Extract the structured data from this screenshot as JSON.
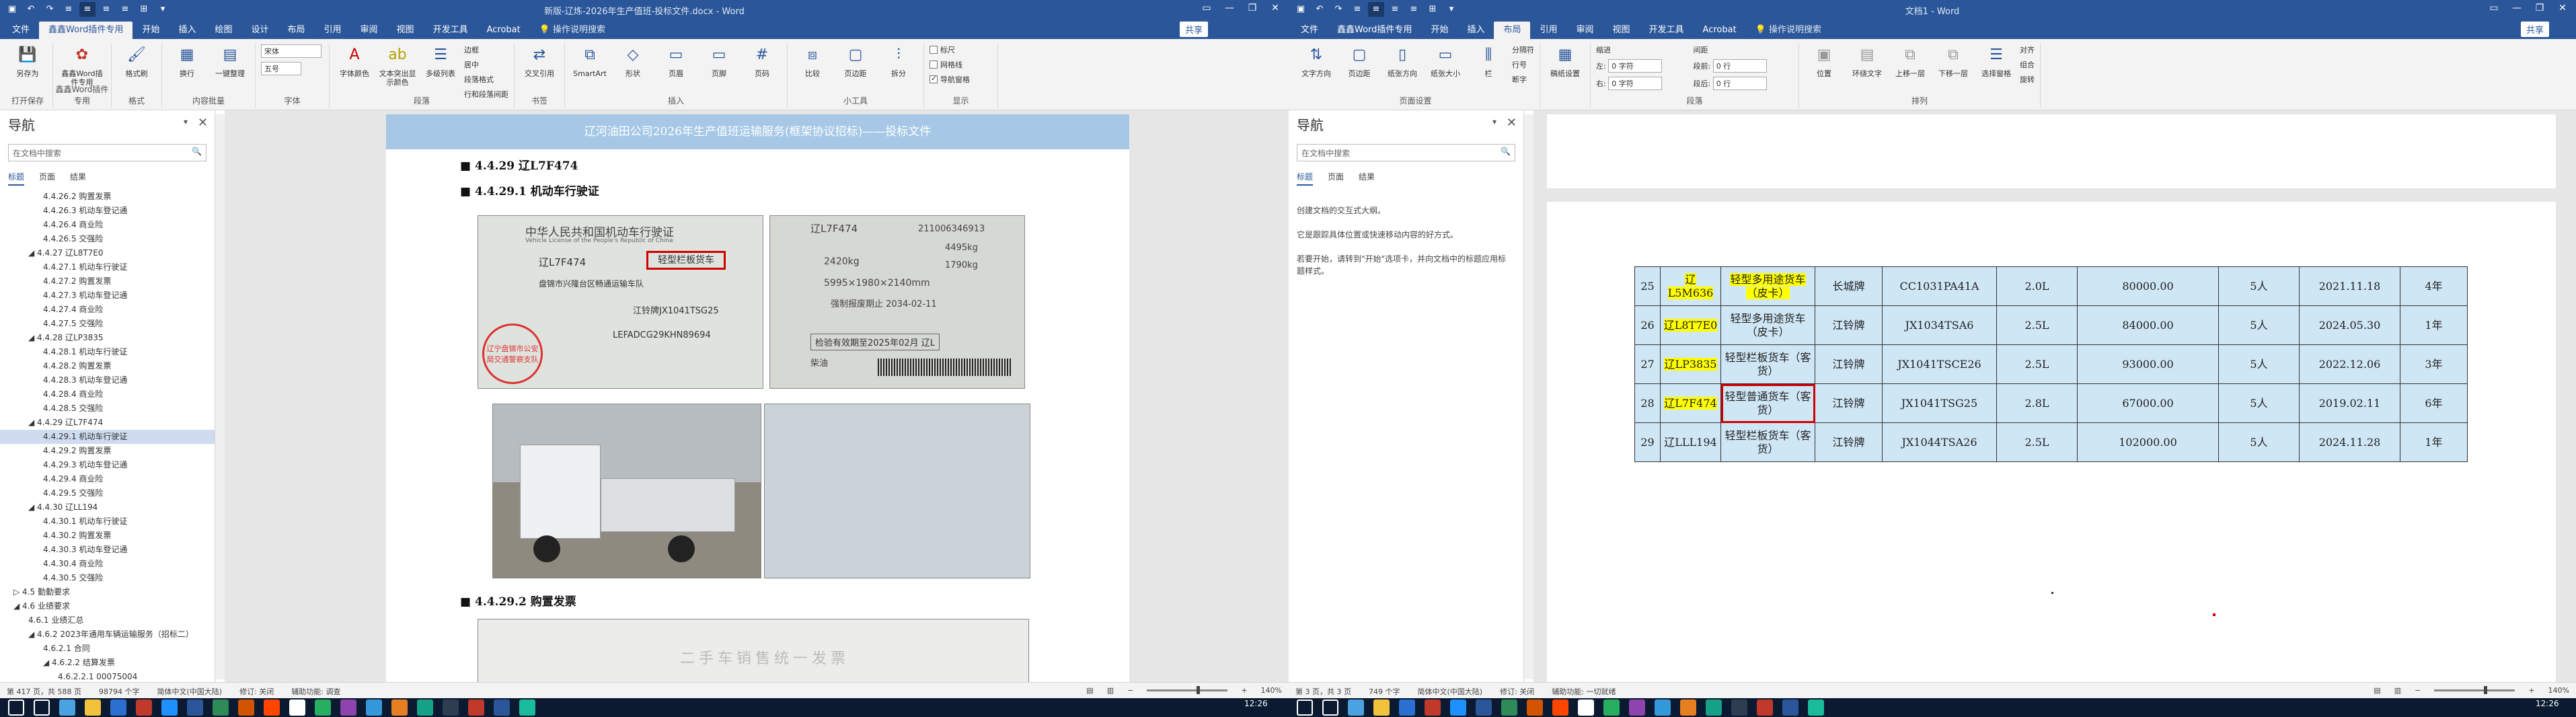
{
  "left": {
    "title": "新版-辽炼-2026年生产值班-投标文件.docx - Word",
    "share": "共享",
    "tabs": [
      "文件",
      "鑫鑫Word插件专用",
      "开始",
      "插入",
      "绘图",
      "设计",
      "布局",
      "引用",
      "审阅",
      "视图",
      "开发工具",
      "Acrobat"
    ],
    "tell_me": "操作说明搜索",
    "ribbon": {
      "g1": {
        "label": "打开保存",
        "buttons": [
          "另存为"
        ]
      },
      "g2": {
        "label": "鑫鑫Word插件专用",
        "buttons": [
          "鑫鑫Word插件专用"
        ]
      },
      "g3": {
        "label": "格式",
        "buttons": [
          "格式刷"
        ]
      },
      "g4": {
        "label": "内容批量",
        "buttons": [
          "换行",
          "一键整理"
        ]
      },
      "g5": {
        "label": "字体",
        "font": "宋体",
        "size": "五号"
      },
      "g6": {
        "label": "段落",
        "buttons": [
          "字体颜色",
          "文本突出显示颜色",
          "多级列表"
        ],
        "small": [
          "边框",
          "居中",
          "段落格式",
          "行和段落间距"
        ]
      },
      "g7": {
        "label": "书签",
        "buttons": [
          "交叉引用"
        ]
      },
      "g8": {
        "label": "插入",
        "buttons": [
          "SmartArt",
          "形状",
          "页眉",
          "页脚",
          "页码"
        ]
      },
      "g9": {
        "label": "小工具",
        "buttons": [
          "比较",
          "页边距",
          "拆分"
        ]
      },
      "g10": {
        "label": "显示",
        "checks": [
          {
            "text": "标尺",
            "on": false
          },
          {
            "text": "网格线",
            "on": false
          },
          {
            "text": "导航窗格",
            "on": true
          }
        ]
      }
    },
    "nav": {
      "title": "导航",
      "search_placeholder": "在文档中搜索",
      "tabs": [
        "标题",
        "页面",
        "结果"
      ],
      "items": [
        {
          "text": "4.4.26.2 购置发票",
          "level": 3
        },
        {
          "text": "4.4.26.3 机动车登记通",
          "level": 3
        },
        {
          "text": "4.4.26.4 商业险",
          "level": 3
        },
        {
          "text": "4.4.26.5 交强险",
          "level": 3
        },
        {
          "text": "◢ 4.4.27 辽L8T7E0",
          "level": 2
        },
        {
          "text": "4.4.27.1 机动车行驶证",
          "level": 3
        },
        {
          "text": "4.4.27.2 购置发票",
          "level": 3
        },
        {
          "text": "4.4.27.3 机动车登记通",
          "level": 3
        },
        {
          "text": "4.4.27.4 商业险",
          "level": 3
        },
        {
          "text": "4.4.27.5 交强险",
          "level": 3
        },
        {
          "text": "◢ 4.4.28 辽LP3835",
          "level": 2
        },
        {
          "text": "4.4.28.1 机动车行驶证",
          "level": 3
        },
        {
          "text": "4.4.28.2 购置发票",
          "level": 3
        },
        {
          "text": "4.4.28.3 机动车登记通",
          "level": 3
        },
        {
          "text": "4.4.28.4 商业险",
          "level": 3
        },
        {
          "text": "4.4.28.5 交强险",
          "level": 3
        },
        {
          "text": "◢ 4.4.29 辽L7F474",
          "level": 2
        },
        {
          "text": "4.4.29.1 机动车行驶证",
          "level": 3,
          "selected": true
        },
        {
          "text": "4.4.29.2 购置发票",
          "level": 3
        },
        {
          "text": "4.4.29.3 机动车登记通",
          "level": 3
        },
        {
          "text": "4.4.29.4 商业险",
          "level": 3
        },
        {
          "text": "4.4.29.5 交强险",
          "level": 3
        },
        {
          "text": "◢ 4.4.30 辽LL194",
          "level": 2
        },
        {
          "text": "4.4.30.1 机动车行驶证",
          "level": 3
        },
        {
          "text": "4.4.30.2 购置发票",
          "level": 3
        },
        {
          "text": "4.4.30.3 机动车登记通",
          "level": 3
        },
        {
          "text": "4.4.30.4 商业险",
          "level": 3
        },
        {
          "text": "4.4.30.5 交强险",
          "level": 3
        },
        {
          "text": "▷ 4.5 勤勤要求",
          "level": 1
        },
        {
          "text": "◢ 4.6 业绩要求",
          "level": 1
        },
        {
          "text": "4.6.1 业绩汇总",
          "level": 2
        },
        {
          "text": "◢ 4.6.2 2023年通用车辆运输服务（招标二）",
          "level": 2
        },
        {
          "text": "4.6.2.1 合同",
          "level": 3
        },
        {
          "text": "◢ 4.6.2.2 结算发票",
          "level": 3
        },
        {
          "text": "4.6.2.2.1 00075004",
          "level": 4
        }
      ]
    },
    "doc": {
      "header": "辽河油田公司2026年生产值班运输服务(框架协议招标)——投标文件",
      "h1": "4.4.29 辽L7F474",
      "h2": "4.4.29.1 机动车行驶证",
      "h3": "4.4.29.2 购置发票",
      "license": {
        "title": "中华人民共和国机动车行驶证",
        "subtitle": "Vehicle License of the People's Republic of China",
        "plate": "辽L7F474",
        "type": "轻型栏板货车",
        "owner": "盘锦市兴隆台区畅通运输车队",
        "model": "江铃牌JX1041TSG25",
        "vin": "LEFADCG29KHN89694",
        "stamp_text": "辽宁盘锦市公安局交通警察支队",
        "back_plate": "辽L7F474",
        "back_num": "211006346913",
        "weight1": "4495kg",
        "weight2": "1790kg",
        "weight3": "2420kg",
        "dims": "5995×1980×2140mm",
        "scrap": "强制报废期止 2034-02-11",
        "pass": "检验有效期至2025年02月 辽L",
        "fuel": "柴油"
      },
      "invoice_text": "二手车销售统一发票"
    },
    "status": {
      "page": "第 417 页，共 588 页",
      "words": "98794 个字",
      "input": "简体中文(中国大陆)",
      "track": "修订: 关闭",
      "access": "辅助功能: 调查",
      "zoom": "140%"
    }
  },
  "right": {
    "title": "文档1 - Word",
    "share": "共享",
    "tabs": [
      "文件",
      "鑫鑫Word插件专用",
      "开始",
      "插入",
      "布局",
      "引用",
      "审阅",
      "视图",
      "开发工具",
      "Acrobat"
    ],
    "tell_me": "操作说明搜索",
    "ribbon": {
      "g1": {
        "label": "",
        "buttons": [
          "文字方向",
          "页边距",
          "纸张方向",
          "纸张大小",
          "栏"
        ]
      },
      "g2": {
        "label": "页面设置",
        "small": [
          "分隔符",
          "行号",
          "断字"
        ]
      },
      "g3": {
        "label": "",
        "buttons": [
          "稿纸设置"
        ]
      },
      "g4": {
        "label": "段落",
        "indent_left_label": "左:",
        "indent_left": "0 字符",
        "indent_right_label": "右:",
        "indent_right": "0 字符",
        "spacing_before_label": "段前:",
        "spacing_before": "0 行",
        "spacing_after_label": "段后:",
        "spacing_after": "0 行",
        "indent_title": "缩进",
        "spacing_title": "间距"
      },
      "g5": {
        "label": "排列",
        "buttons": [
          "位置",
          "环绕文字",
          "上移一层",
          "下移一层",
          "选择窗格"
        ],
        "small": [
          "对齐",
          "组合",
          "旋转"
        ]
      }
    },
    "nav": {
      "title": "导航",
      "search_placeholder": "在文档中搜索",
      "tabs": [
        "标题",
        "页面",
        "结果"
      ],
      "msg1": "创建文档的交互式大纲。",
      "msg2": "它是跟踪具体位置或快速移动内容的好方式。",
      "msg3": "若要开始，请转到\"开始\"选项卡，并向文档中的标题应用标题样式。"
    },
    "table": [
      {
        "no": "25",
        "plate": "辽L5M636",
        "type": "轻型多用途货车（皮卡）",
        "brand": "长城牌",
        "model": "CC1031PA41A",
        "disp": "2.0L",
        "price": "80000.00",
        "seats": "5人",
        "date": "2021.11.18",
        "years": "4年",
        "plate_hl": true,
        "type_hl": true
      },
      {
        "no": "26",
        "plate": "辽L8T7E0",
        "type": "轻型多用途货车（皮卡）",
        "brand": "江铃牌",
        "model": "JX1034TSA6",
        "disp": "2.5L",
        "price": "84000.00",
        "seats": "5人",
        "date": "2024.05.30",
        "years": "1年",
        "plate_hl": true
      },
      {
        "no": "27",
        "plate": "辽LP3835",
        "type": "轻型栏板货车（客货）",
        "brand": "江铃牌",
        "model": "JX1041TSCE26",
        "disp": "2.5L",
        "price": "93000.00",
        "seats": "5人",
        "date": "2022.12.06",
        "years": "3年",
        "plate_hl": true
      },
      {
        "no": "28",
        "plate": "辽L7F474",
        "type": "轻型普通货车（客货）",
        "brand": "江铃牌",
        "model": "JX1041TSG25",
        "disp": "2.8L",
        "price": "67000.00",
        "seats": "5人",
        "date": "2019.02.11",
        "years": "6年",
        "plate_hl": true,
        "type_red": true
      },
      {
        "no": "29",
        "plate": "辽LLL194",
        "type": "轻型栏板货车（客货）",
        "brand": "江铃牌",
        "model": "JX1044TSA26",
        "disp": "2.5L",
        "price": "102000.00",
        "seats": "5人",
        "date": "2024.11.28",
        "years": "1年"
      }
    ],
    "status": {
      "page": "第 3 页，共 3 页",
      "words": "749 个字",
      "input": "简体中文(中国大陆)",
      "track": "修订: 关闭",
      "access": "辅助功能: 一切就绪",
      "zoom": "140%"
    }
  },
  "taskbar": {
    "time1": "12:26",
    "time2": "12:26"
  }
}
